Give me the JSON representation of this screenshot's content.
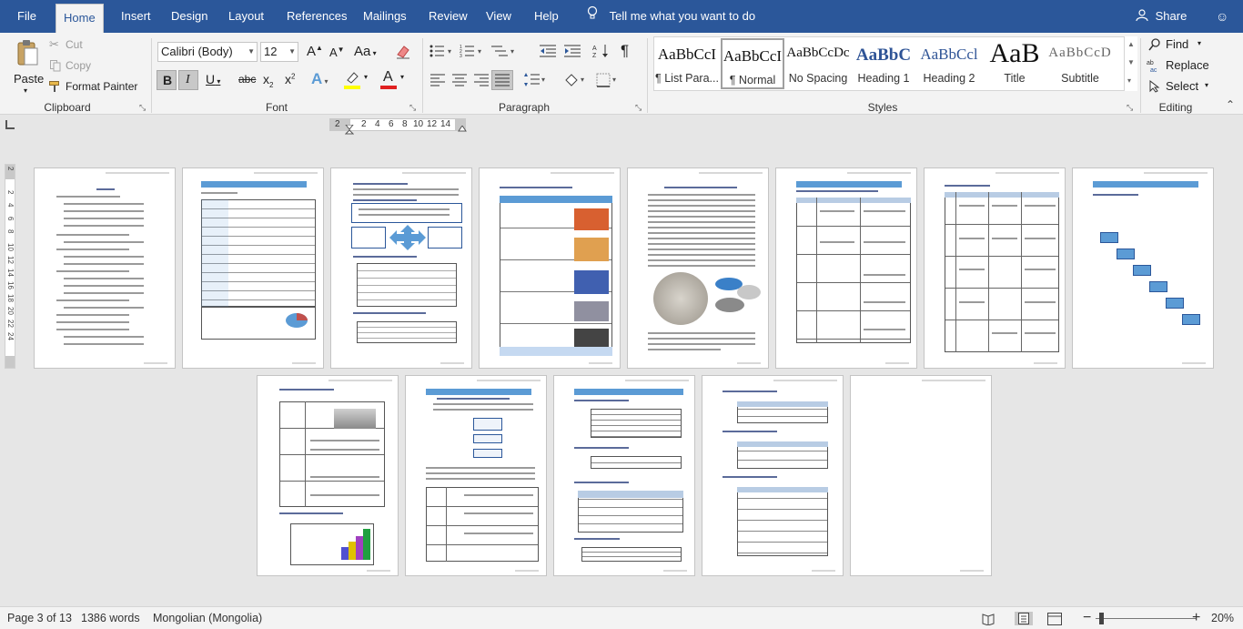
{
  "tabs": [
    "File",
    "Home",
    "Insert",
    "Design",
    "Layout",
    "References",
    "Mailings",
    "Review",
    "View",
    "Help"
  ],
  "active_tab": "Home",
  "tell_me": "Tell me what you want to do",
  "share_label": "Share",
  "clipboard": {
    "paste": "Paste",
    "cut": "Cut",
    "copy": "Copy",
    "format_painter": "Format Painter",
    "label": "Clipboard"
  },
  "font": {
    "name": "Calibri (Body)",
    "size": "12",
    "grow": "A",
    "shrink": "A",
    "case": "Aa",
    "bold": "B",
    "italic": "I",
    "underline": "U",
    "strike": "abc",
    "subscript": "x",
    "superscript": "x",
    "effects": "A",
    "font_color": "A",
    "label": "Font"
  },
  "paragraph": {
    "label": "Paragraph",
    "pilcrow": "¶"
  },
  "styles": {
    "items": [
      {
        "sample": "AaBbCcI",
        "name": "¶ List Para..."
      },
      {
        "sample": "AaBbCcI",
        "name": "¶ Normal"
      },
      {
        "sample": "AaBbCcDc",
        "name": "No Spacing"
      },
      {
        "sample": "AaBbC",
        "name": "Heading 1"
      },
      {
        "sample": "AaBbCcl",
        "name": "Heading 2"
      },
      {
        "sample": "AaB",
        "name": "Title"
      },
      {
        "sample": "AaBbCcD",
        "name": "Subtitle"
      }
    ],
    "selected": 1,
    "label": "Styles"
  },
  "editing": {
    "find": "Find",
    "replace": "Replace",
    "select": "Select",
    "label": "Editing"
  },
  "ruler_numbers": [
    "2",
    "2",
    "4",
    "6",
    "8",
    "10",
    "12",
    "14"
  ],
  "vertical_ruler_numbers": [
    "2",
    "2",
    "4",
    "6",
    "8",
    "10",
    "12",
    "14",
    "16",
    "18",
    "20",
    "22",
    "24"
  ],
  "status": {
    "page": "Page 3 of 13",
    "words": "1386 words",
    "language": "Mongolian (Mongolia)",
    "zoom": "20%"
  },
  "colors": {
    "brand": "#2b579a",
    "ribbon_bg": "#f3f3f3",
    "canvas_bg": "#e6e6e6",
    "accent_blue": "#5b9bd5"
  }
}
